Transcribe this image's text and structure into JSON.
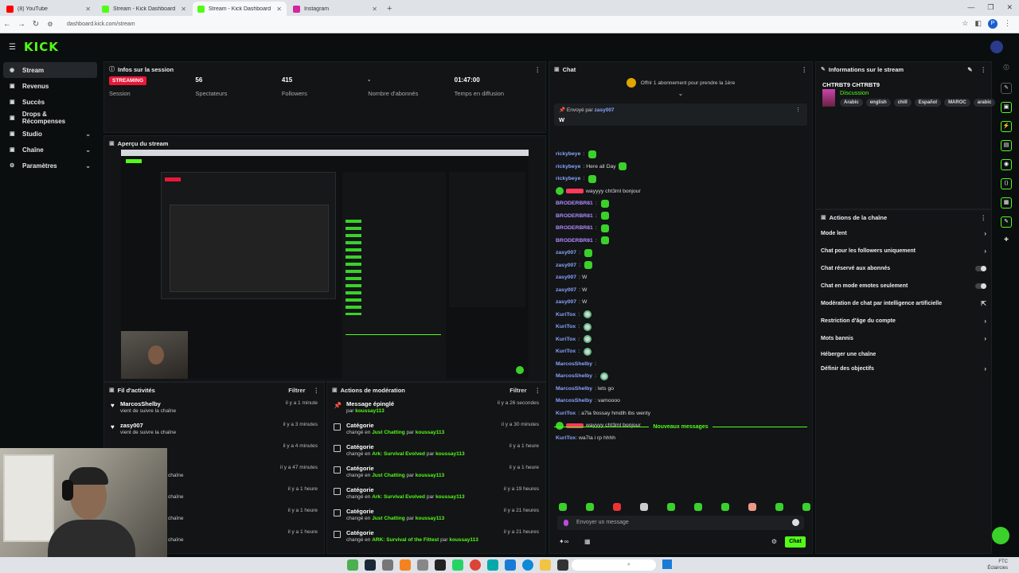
{
  "browser": {
    "tabs": [
      {
        "label": "(8) YouTube",
        "color": "#ff0000"
      },
      {
        "label": "Stream - Kick Dashboard",
        "color": "#53fc18"
      },
      {
        "label": "Stream - Kick Dashboard",
        "color": "#53fc18",
        "active": true
      },
      {
        "label": "Instagram",
        "color": "#d6249f"
      }
    ],
    "url": "dashboard.kick.com/stream",
    "profile_initial": "P"
  },
  "brand": {
    "logo": "KICK",
    "accent": "#53fc18"
  },
  "sidebar": {
    "items": [
      {
        "label": "Stream",
        "icon": "broadcast-icon",
        "active": true
      },
      {
        "label": "Revenus",
        "icon": "wallet-icon"
      },
      {
        "label": "Succès",
        "icon": "trophy-icon"
      },
      {
        "label": "Drops & Récompenses",
        "icon": "gift-icon"
      },
      {
        "label": "Studio",
        "icon": "studio-icon",
        "expand": true
      },
      {
        "label": "Chaîne",
        "icon": "channel-icon",
        "expand": true
      },
      {
        "label": "Paramètres",
        "icon": "gear-icon",
        "expand": true
      }
    ]
  },
  "session": {
    "title": "Infos sur la session",
    "badge": "STREAMING",
    "badge_label": "Session",
    "stats": [
      {
        "value": "56",
        "label": "Spectateurs"
      },
      {
        "value": "415",
        "label": "Followers"
      },
      {
        "value": "-",
        "label": "Nombre d'abonnés"
      },
      {
        "value": "01:47:00",
        "label": "Temps en diffusion"
      }
    ]
  },
  "preview": {
    "title": "Aperçu du stream"
  },
  "activity": {
    "title": "Fil d'activités",
    "filter": "Filtrer",
    "items": [
      {
        "name": "MarcosShelby",
        "sub": "vient de suivre la chaîne",
        "time": "il y a 1 minute"
      },
      {
        "name": "zasy007",
        "sub": "vient de suivre la chaîne",
        "time": "il y a 3 minutes"
      },
      {
        "name": "",
        "sub": "",
        "time": "il y a 4 minutes"
      },
      {
        "name": "",
        "sub": "chaîne",
        "time": "il y a 47 minutes"
      },
      {
        "name": "",
        "sub": "chaîne",
        "time": "il y a 1 heure"
      },
      {
        "name": "",
        "sub": "chaîne",
        "time": "il y a 1 heure"
      },
      {
        "name": "",
        "sub": "chaîne",
        "time": "il y a 1 heure"
      }
    ]
  },
  "moderation": {
    "title": "Actions de modération",
    "filter": "Filtrer",
    "items": [
      {
        "name": "Message épinglé",
        "prefix": "par",
        "user": "koussay113",
        "time": "il y a 26 secondes",
        "icon": "pin-icon"
      },
      {
        "name": "Catégorie",
        "prefix": "changé en",
        "cat": "Just Chatting",
        "user": "koussay113",
        "time": "il y a 30 minutes"
      },
      {
        "name": "Catégorie",
        "prefix": "changé en",
        "cat": "Ark: Survival Evolved",
        "user": "koussay113",
        "time": "il y a 1 heure"
      },
      {
        "name": "Catégorie",
        "prefix": "changé en",
        "cat": "Just Chatting",
        "user": "koussay113",
        "time": "il y a 1 heure"
      },
      {
        "name": "Catégorie",
        "prefix": "changé en",
        "cat": "Ark: Survival Evolved",
        "user": "koussay113",
        "time": "il y a 19 heures"
      },
      {
        "name": "Catégorie",
        "prefix": "changé en",
        "cat": "Just Chatting",
        "user": "koussay113",
        "time": "il y a 21 heures"
      },
      {
        "name": "Catégorie",
        "prefix": "changé en",
        "cat": "ARK: Survival of the Fittest",
        "user": "koussay113",
        "time": "il y a 21 heures"
      }
    ],
    "par": "par"
  },
  "chat": {
    "title": "Chat",
    "gift_text": "Offrir 1 abonnement pour prendre la 1ère",
    "pinned_prefix": "Envoyé par",
    "pinned_user": "zasy007",
    "pinned_msg": "W",
    "lines": [
      {
        "user": "rickybeye",
        "color": "#8aa4ff",
        "text": "",
        "emotes": 1
      },
      {
        "user": "rickybeye",
        "color": "#8aa4ff",
        "text": "Here all Day",
        "emotes": 1
      },
      {
        "user": "rickybeye",
        "color": "#8aa4ff",
        "text": "",
        "emotes": 1
      },
      {
        "user": "",
        "color": "#ff3b5c",
        "text": "wayyyy cht3ml bonjour",
        "emotes": 0,
        "badge": true
      },
      {
        "user": "BRODERBR81",
        "color": "#b08cff",
        "text": "",
        "emotes": 1
      },
      {
        "user": "BRODERBR81",
        "color": "#b08cff",
        "text": "",
        "emotes": 1
      },
      {
        "user": "BRODERBR81",
        "color": "#b08cff",
        "text": "",
        "emotes": 1
      },
      {
        "user": "BRODERBR81",
        "color": "#b08cff",
        "text": "",
        "emotes": 1
      },
      {
        "user": "zasy007",
        "color": "#8aa4ff",
        "text": "",
        "emotes": 1
      },
      {
        "user": "zasy007",
        "color": "#8aa4ff",
        "text": "",
        "emotes": 1
      },
      {
        "user": "zasy007",
        "color": "#8aa4ff",
        "text": "W",
        "emotes": 0
      },
      {
        "user": "zasy007",
        "color": "#8aa4ff",
        "text": "W",
        "emotes": 0
      },
      {
        "user": "zasy007",
        "color": "#8aa4ff",
        "text": "W",
        "emotes": 0
      },
      {
        "user": "KuriTox",
        "color": "#8aa4ff",
        "text": "",
        "emotes": 2
      },
      {
        "user": "KuriTox",
        "color": "#8aa4ff",
        "text": "",
        "emotes": 2
      },
      {
        "user": "KuriTox",
        "color": "#8aa4ff",
        "text": "",
        "emotes": 2
      },
      {
        "user": "KuriTox",
        "color": "#8aa4ff",
        "text": "",
        "emotes": 2
      },
      {
        "user": "MarcosShelby",
        "color": "#8aa4ff",
        "text": "",
        "emotes": 0
      },
      {
        "user": "MarcosShelby",
        "color": "#8aa4ff",
        "text": "",
        "emotes": 2
      },
      {
        "user": "MarcosShelby",
        "color": "#8aa4ff",
        "text": "lets go",
        "emotes": 0
      },
      {
        "user": "MarcosShelby",
        "color": "#8aa4ff",
        "text": "vamoooo",
        "emotes": 0
      },
      {
        "user": "KuriTox",
        "color": "#8aa4ff",
        "text": "a7la 9ossay hmdlh ibs wenty",
        "emotes": 0
      },
      {
        "user": "",
        "color": "#ff3b5c",
        "text": "wayyyy cht3ml bonjour",
        "emotes": 0,
        "badge": true
      }
    ],
    "new_messages": "Nouveaux messages",
    "after_line": {
      "user": "KuriTox",
      "text": "wa7la i rp hhhh"
    },
    "input_placeholder": "Envoyer un message",
    "send": "Chat"
  },
  "stream_info": {
    "title": "Informations sur le stream",
    "stream_title": "CHTRBT9 CHTRBT9",
    "category": "Discussion",
    "tags": [
      "Arabic",
      "english",
      "chill",
      "Español",
      "MAROC",
      "arabic"
    ]
  },
  "channel_actions": {
    "title": "Actions de la chaîne",
    "items": [
      {
        "label": "Mode lent",
        "control": "arrow"
      },
      {
        "label": "Chat pour les followers uniquement",
        "control": "arrow"
      },
      {
        "label": "Chat réservé aux abonnés",
        "control": "toggle"
      },
      {
        "label": "Chat en mode emotes seulement",
        "control": "toggle"
      },
      {
        "label": "Modération de chat par intelligence artificielle",
        "control": "external"
      },
      {
        "label": "Restriction d'âge du compte",
        "control": "arrow"
      },
      {
        "label": "Mots bannis",
        "control": "arrow"
      },
      {
        "label": "Héberger une chaîne",
        "control": "none"
      },
      {
        "label": "Définir des objectifs",
        "control": "arrow"
      }
    ]
  },
  "taskbar": {
    "clock_line1": "FTC",
    "clock_line2": "Éclaircies"
  }
}
